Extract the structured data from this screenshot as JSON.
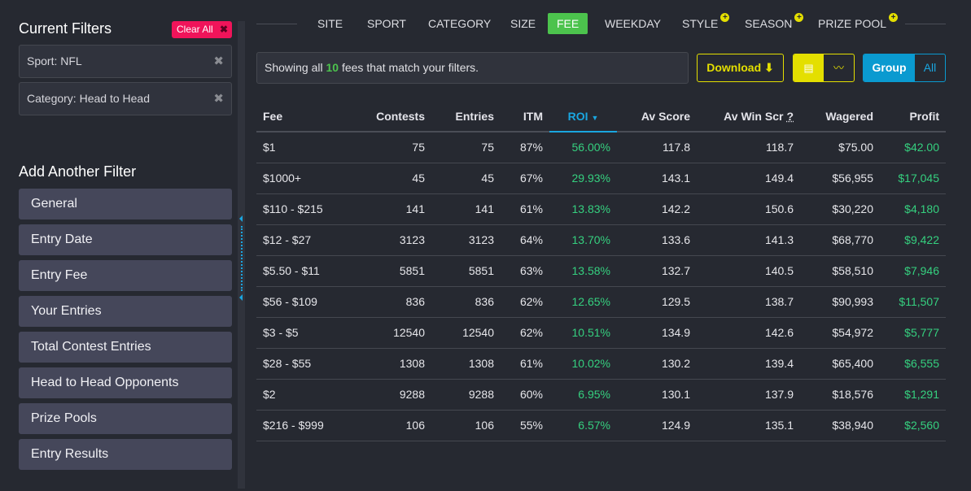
{
  "sidebar": {
    "current_title": "Current Filters",
    "clear_all": "Clear All",
    "filters": [
      "Sport: NFL",
      "Category: Head to Head"
    ],
    "add_title": "Add Another Filter",
    "add_items": [
      "General",
      "Entry Date",
      "Entry Fee",
      "Your Entries",
      "Total Contest Entries",
      "Head to Head Opponents",
      "Prize Pools",
      "Entry Results"
    ]
  },
  "tabs": [
    {
      "label": "SITE"
    },
    {
      "label": "SPORT"
    },
    {
      "label": "CATEGORY"
    },
    {
      "label": "SIZE"
    },
    {
      "label": "FEE",
      "active": true
    },
    {
      "label": "WEEKDAY"
    },
    {
      "label": "STYLE",
      "plus": true
    },
    {
      "label": "SEASON",
      "plus": true
    },
    {
      "label": "PRIZE POOL",
      "plus": true
    }
  ],
  "info": {
    "prefix": "Showing all ",
    "count": "10",
    "suffix": " fees that match your filters."
  },
  "toolbar": {
    "download": "Download",
    "group": "Group",
    "all": "All"
  },
  "colors": {
    "accent_yellow": "#e4df00",
    "accent_green": "#4cc34d",
    "accent_blue": "#0a9ad0",
    "profit_green": "#35d07f",
    "clear_red": "#f0145a"
  },
  "table": {
    "columns": [
      "Fee",
      "Contests",
      "Entries",
      "ITM",
      "ROI",
      "Av Score",
      "Av Win Scr",
      "Wagered",
      "Profit"
    ],
    "help_mark": "?",
    "sorted_column": "ROI",
    "rows": [
      [
        "$1",
        "75",
        "75",
        "87%",
        "56.00%",
        "117.8",
        "118.7",
        "$75.00",
        "$42.00"
      ],
      [
        "$1000+",
        "45",
        "45",
        "67%",
        "29.93%",
        "143.1",
        "149.4",
        "$56,955",
        "$17,045"
      ],
      [
        "$110 - $215",
        "141",
        "141",
        "61%",
        "13.83%",
        "142.2",
        "150.6",
        "$30,220",
        "$4,180"
      ],
      [
        "$12 - $27",
        "3123",
        "3123",
        "64%",
        "13.70%",
        "133.6",
        "141.3",
        "$68,770",
        "$9,422"
      ],
      [
        "$5.50 - $11",
        "5851",
        "5851",
        "63%",
        "13.58%",
        "132.7",
        "140.5",
        "$58,510",
        "$7,946"
      ],
      [
        "$56 - $109",
        "836",
        "836",
        "62%",
        "12.65%",
        "129.5",
        "138.7",
        "$90,993",
        "$11,507"
      ],
      [
        "$3 - $5",
        "12540",
        "12540",
        "62%",
        "10.51%",
        "134.9",
        "142.6",
        "$54,972",
        "$5,777"
      ],
      [
        "$28 - $55",
        "1308",
        "1308",
        "61%",
        "10.02%",
        "130.2",
        "139.4",
        "$65,400",
        "$6,555"
      ],
      [
        "$2",
        "9288",
        "9288",
        "60%",
        "6.95%",
        "130.1",
        "137.9",
        "$18,576",
        "$1,291"
      ],
      [
        "$216 - $999",
        "106",
        "106",
        "55%",
        "6.57%",
        "124.9",
        "135.1",
        "$38,940",
        "$2,560"
      ]
    ]
  }
}
